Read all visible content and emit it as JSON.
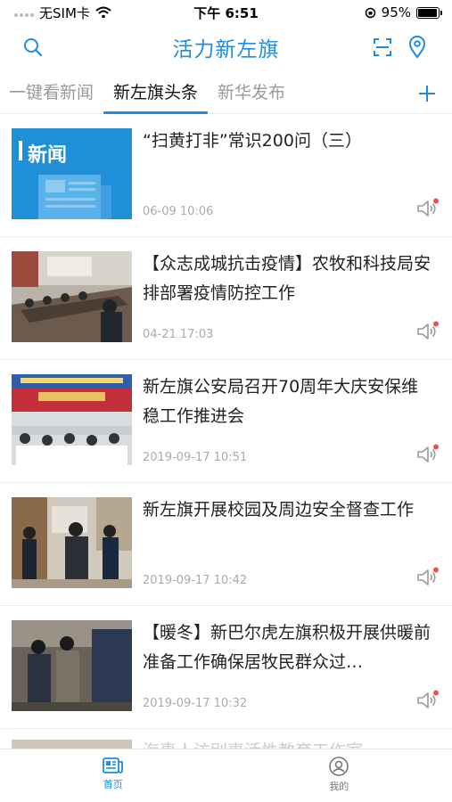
{
  "status_bar": {
    "carrier": "无SIM卡",
    "time": "下午 6:51",
    "battery": "95%",
    "battery_level": 0.95
  },
  "header": {
    "title": "活力新左旗",
    "icons": [
      "search-icon",
      "scan-icon",
      "location-icon"
    ]
  },
  "tabs": [
    {
      "label": "一键看新闻",
      "active": false
    },
    {
      "label": "新左旗头条",
      "active": true
    },
    {
      "label": "新华发布",
      "active": false
    }
  ],
  "news": [
    {
      "title": "“扫黄打非”常识200问（三）",
      "time": "06-09 10:06",
      "thumb_badge": "新闻"
    },
    {
      "title": "【众志成城抗击疫情】农牧和科技局安排部署疫情防控工作",
      "time": "04-21 17:03"
    },
    {
      "title": "新左旗公安局召开70周年大庆安保维稳工作推进会",
      "time": "2019-09-17 10:51"
    },
    {
      "title": "新左旗开展校园及周边安全督查工作",
      "time": "2019-09-17 10:42"
    },
    {
      "title": "【暖冬】新巴尔虎左旗积极开展供暖前准备工作确保居牧民群众过…",
      "time": "2019-09-17 10:32"
    }
  ],
  "partial_news": {
    "title": "海事人访别事活性教育工作室"
  },
  "bottom_nav": [
    {
      "label": "首页",
      "active": true
    },
    {
      "label": "我的",
      "active": false
    }
  ],
  "colors": {
    "accent": "#1e8ce0",
    "badge_dot": "#f05050"
  }
}
